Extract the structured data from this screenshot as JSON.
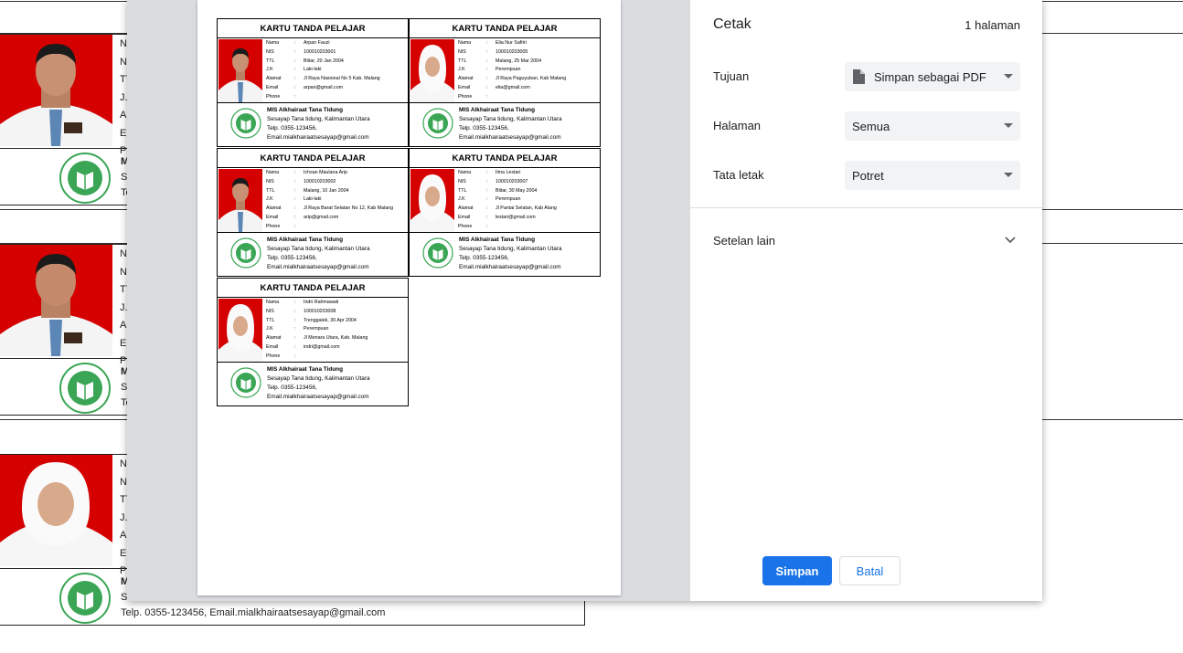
{
  "background": {
    "field_initials": [
      "Na",
      "NI",
      "TT",
      "J.",
      "Al",
      "Er",
      "Ph"
    ],
    "school_initial": "M",
    "card3_footer": [
      "S",
      "Telp. 0355-123456, Email.mialkhairaatsesayap@gmail.com"
    ],
    "short_footer": [
      "Se",
      "Te"
    ]
  },
  "dialog": {
    "title": "Cetak",
    "page_count": "1 halaman",
    "destination_label": "Tujuan",
    "destination_value": "Simpan sebagai PDF",
    "pages_label": "Halaman",
    "pages_value": "Semua",
    "layout_label": "Tata letak",
    "layout_value": "Potret",
    "more_settings": "Setelan lain",
    "save_button": "Simpan",
    "cancel_button": "Batal"
  },
  "card_template": {
    "title": "KARTU TANDA PELAJAR",
    "field_labels": [
      "Nama",
      "NIS",
      "TTL",
      "J.K",
      "Alamat",
      "Email",
      "Phone"
    ],
    "separator": ":",
    "school_name": "MIS Alkhairaat Tana Tidung",
    "school_address": "Sesayap Tana tidung, Kalimantan Utara",
    "school_phone": "Telp. 0355-123456,",
    "school_email": "Email.mialkhairaatsesayap@gmail.com"
  },
  "cards": [
    {
      "nama": "Arpan Fauzi",
      "nis": "100010203001",
      "ttl": "Blitar, 20 Jan 2004",
      "jk": "Laki-laki",
      "alamat": "Jl Raya Nasional No 5 Kab. Malang",
      "email": "arpan@gmail.com",
      "phone": "",
      "gender": "m"
    },
    {
      "nama": "Elia Nur Safitri",
      "nis": "100010203005",
      "ttl": "Malang, 25 Mar 2004",
      "jk": "Perempuan",
      "alamat": "Jl Raya Paguyuban, Kab Malang",
      "email": "elia@gmail.com",
      "phone": "",
      "gender": "f"
    },
    {
      "nama": "Ichsan Maulana Arip",
      "nis": "100010203002",
      "ttl": "Malang, 10 Jan 2004",
      "jk": "Laki-laki",
      "alamat": "Jl Raya Barat Selatan No 12, Kab Malang",
      "email": "arip@gmail.com",
      "phone": "",
      "gender": "m"
    },
    {
      "nama": "Ilma Lestari",
      "nis": "100010203007",
      "ttl": "Blitar, 30 May 2004",
      "jk": "Perempuan",
      "alamat": "Jl Pantai Selatan, Kab Alang",
      "email": "lestari@gmail.com",
      "phone": "",
      "gender": "f"
    },
    {
      "nama": "Indri Rahmawati",
      "nis": "100010203008",
      "ttl": "Trenggalek, 30 Apr 2004",
      "jk": "Perempuan",
      "alamat": "Jl Menara Utara, Kab. Malang",
      "email": "indri@gmail.com",
      "phone": "",
      "gender": "f"
    }
  ],
  "colors": {
    "photo_background": "#d50000",
    "primary_button": "#1a73e8",
    "logo_green": "#3aa655"
  },
  "icons": {
    "document": "document-icon",
    "caret": "caret-down-icon",
    "chevron": "chevron-down-icon",
    "logo": "school-logo-icon"
  }
}
